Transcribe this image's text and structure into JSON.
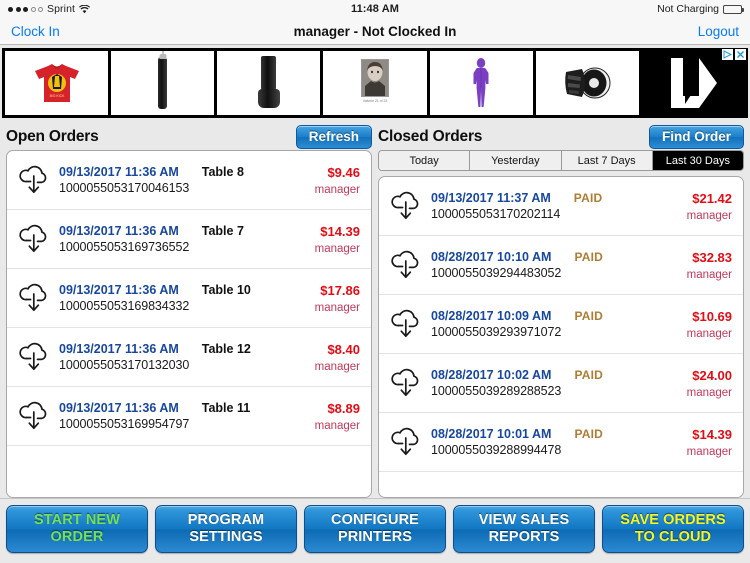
{
  "status_bar": {
    "carrier": "Sprint",
    "signal_filled": 3,
    "signal_empty": 2,
    "wifi_icon": "wifi-icon",
    "time": "11:48 AM",
    "battery_text": "Not Charging",
    "battery_icon": "battery-icon"
  },
  "nav": {
    "left_label": "Clock In",
    "title": "manager - Not Clocked In",
    "right_label": "Logout"
  },
  "ad_banner": {
    "adchoices_label": "AdChoices",
    "close_label": "x",
    "cells": [
      {
        "name": "red-tshirt-ad",
        "caption": ""
      },
      {
        "name": "long-punching-bag-ad",
        "caption": ""
      },
      {
        "name": "standing-punching-bag-ad",
        "caption": ""
      },
      {
        "name": "portrait-volume-ad",
        "caption": "Volume 21 of 23"
      },
      {
        "name": "purple-body-suit-ad",
        "caption": ""
      },
      {
        "name": "focus-mitts-ad",
        "caption": ""
      },
      {
        "name": "black-arrow-ad",
        "caption": ""
      }
    ]
  },
  "open_orders": {
    "title": "Open Orders",
    "refresh_label": "Refresh",
    "rows": [
      {
        "icon": "cloud-download-icon",
        "date": "09/13/2017 11:36 AM",
        "middle": "Table 8",
        "id": "1000055053170046153",
        "amount": "$9.46",
        "user": "manager"
      },
      {
        "icon": "cloud-download-icon",
        "date": "09/13/2017 11:36 AM",
        "middle": "Table 7",
        "id": "1000055053169736552",
        "amount": "$14.39",
        "user": "manager"
      },
      {
        "icon": "cloud-download-icon",
        "date": "09/13/2017 11:36 AM",
        "middle": "Table 10",
        "id": "1000055053169834332",
        "amount": "$17.86",
        "user": "manager"
      },
      {
        "icon": "cloud-download-icon",
        "date": "09/13/2017 11:36 AM",
        "middle": "Table 12",
        "id": "1000055053170132030",
        "amount": "$8.40",
        "user": "manager"
      },
      {
        "icon": "cloud-download-icon",
        "date": "09/13/2017 11:36 AM",
        "middle": "Table 11",
        "id": "1000055053169954797",
        "amount": "$8.89",
        "user": "manager"
      }
    ]
  },
  "closed_orders": {
    "title": "Closed Orders",
    "find_label": "Find Order",
    "filters": [
      {
        "label": "Today",
        "active": false
      },
      {
        "label": "Yesterday",
        "active": false
      },
      {
        "label": "Last 7 Days",
        "active": false
      },
      {
        "label": "Last 30 Days",
        "active": true
      }
    ],
    "rows": [
      {
        "icon": "cloud-download-icon",
        "date": "09/13/2017 11:37 AM",
        "middle": "PAID",
        "id": "1000055053170202114",
        "amount": "$21.42",
        "user": "manager"
      },
      {
        "icon": "cloud-download-icon",
        "date": "08/28/2017 10:10 AM",
        "middle": "PAID",
        "id": "1000055039294483052",
        "amount": "$32.83",
        "user": "manager"
      },
      {
        "icon": "cloud-download-icon",
        "date": "08/28/2017 10:09 AM",
        "middle": "PAID",
        "id": "1000055039293971072",
        "amount": "$10.69",
        "user": "manager"
      },
      {
        "icon": "cloud-download-icon",
        "date": "08/28/2017 10:02 AM",
        "middle": "PAID",
        "id": "1000055039289288523",
        "amount": "$24.00",
        "user": "manager"
      },
      {
        "icon": "cloud-download-icon",
        "date": "08/28/2017 10:01 AM",
        "middle": "PAID",
        "id": "1000055039288994478",
        "amount": "$14.39",
        "user": "manager"
      }
    ]
  },
  "toolbar": {
    "buttons": [
      {
        "line1": "START NEW",
        "line2": "ORDER",
        "style": "green"
      },
      {
        "line1": "PROGRAM",
        "line2": "SETTINGS",
        "style": "white"
      },
      {
        "line1": "CONFIGURE",
        "line2": "PRINTERS",
        "style": "white"
      },
      {
        "line1": "VIEW SALES",
        "line2": "REPORTS",
        "style": "white"
      },
      {
        "line1": "SAVE ORDERS",
        "line2": "TO CLOUD",
        "style": "yellow"
      }
    ]
  },
  "colors": {
    "accent_blue": "#077bfc",
    "button_blue": "#1277c2",
    "amount_red": "#e00d16",
    "date_blue": "#17479e",
    "paid_tan": "#b07c33",
    "user_rose": "#c0395a",
    "green_text": "#75e05a",
    "yellow_text": "#f5f520"
  }
}
